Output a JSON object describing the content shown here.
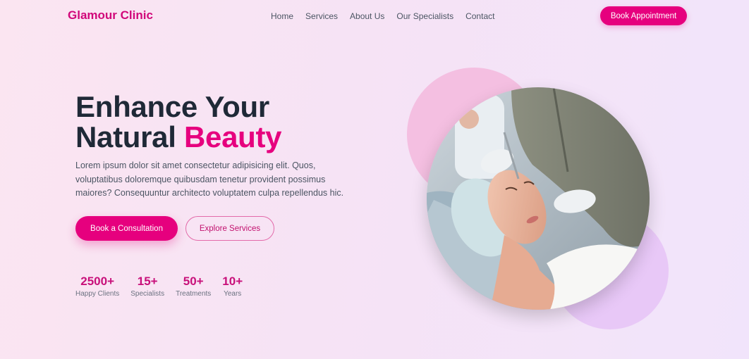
{
  "nav": {
    "logo": "Glamour Clinic",
    "items": [
      {
        "label": "Home"
      },
      {
        "label": "Services"
      },
      {
        "label": "About Us"
      },
      {
        "label": "Our Specialists"
      },
      {
        "label": "Contact"
      }
    ],
    "cta": "Book Appointment"
  },
  "hero": {
    "title_line1": "Enhance Your",
    "title_line2_prefix": "Natural ",
    "title_accent": "Beauty",
    "description": "Lorem ipsum dolor sit amet consectetur adipisicing elit. Quos, voluptatibus doloremque quibusdam tenetur provident possimus maiores? Consequuntur architecto voluptatem culpa repellendus hic.",
    "primary_button": "Book a Consultation",
    "secondary_button": "Explore Services"
  },
  "stats": [
    {
      "value": "2500+",
      "label": "Happy Clients"
    },
    {
      "value": "15+",
      "label": "Specialists"
    },
    {
      "value": "50+",
      "label": "Treatments"
    },
    {
      "value": "10+",
      "label": "Years"
    }
  ],
  "colors": {
    "brand": "#e6007e",
    "heading": "#1f2937",
    "blob_pink": "#f4bfe1",
    "blob_purple": "#e8c8f7"
  }
}
